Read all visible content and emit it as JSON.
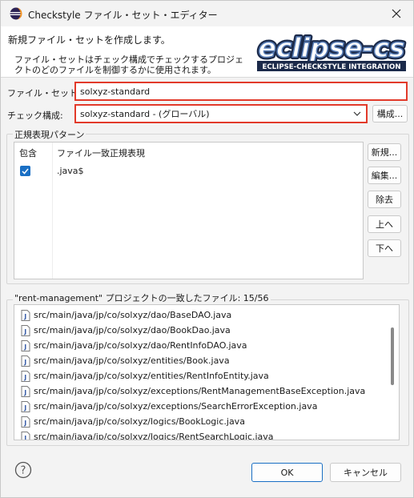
{
  "window": {
    "title": "Checkstyle ファイル・セット・エディター",
    "close_label": "✕"
  },
  "banner": {
    "title": "新規ファイル・セットを作成します。",
    "description": "ファイル・セットはチェック構成でチェックするプロジェクトのどのファイルを制御するかに使用されます。",
    "logo_text": "eclipse-cs",
    "logo_subtext": "ECLIPSE-CHECKSTYLE INTEGRATION"
  },
  "form": {
    "fileset_name_label": "ファイル・セット名:",
    "fileset_name_value": "solxyz-standard",
    "check_config_label": "チェック構成:",
    "check_config_value": "solxyz-standard  - (グローバル)",
    "configure_button": "構成..."
  },
  "patterns": {
    "group_label": "正規表現パターン",
    "columns": [
      "包含",
      "ファイル一致正規表現"
    ],
    "rows": [
      {
        "included": true,
        "pattern": ".java$"
      }
    ],
    "buttons": {
      "new": "新規...",
      "edit": "編集...",
      "remove": "除去",
      "up": "上へ",
      "down": "下へ"
    }
  },
  "matched": {
    "group_label": "\"rent-management\" プロジェクトの一致したファイル: 15/56",
    "files": [
      "src/main/java/jp/co/solxyz/dao/BaseDAO.java",
      "src/main/java/jp/co/solxyz/dao/BookDao.java",
      "src/main/java/jp/co/solxyz/dao/RentInfoDAO.java",
      "src/main/java/jp/co/solxyz/entities/Book.java",
      "src/main/java/jp/co/solxyz/entities/RentInfoEntity.java",
      "src/main/java/jp/co/solxyz/exceptions/RentManagementBaseException.java",
      "src/main/java/jp/co/solxyz/exceptions/SearchErrorException.java",
      "src/main/java/jp/co/solxyz/logics/BookLogic.java",
      "src/main/java/jp/co/solxyz/logics/RentSearchLogic.java"
    ]
  },
  "footer": {
    "ok_button": "OK",
    "cancel_button": "キャンセル"
  },
  "colors": {
    "highlight": "#e23a2a",
    "accent": "#1a6fc4"
  }
}
